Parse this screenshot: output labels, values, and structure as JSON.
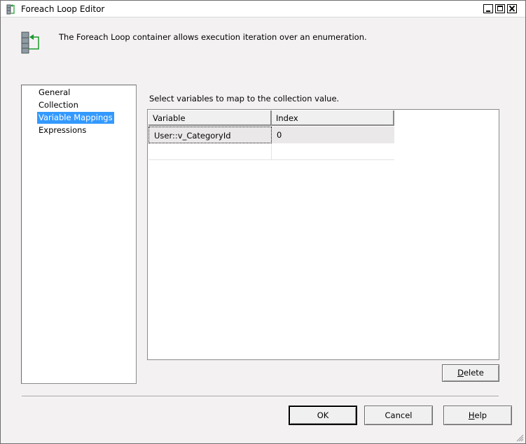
{
  "window": {
    "title": "Foreach Loop Editor"
  },
  "header": {
    "description": "The Foreach Loop container allows execution iteration over an enumeration.",
    "icon": "foreach-loop-icon"
  },
  "nav": {
    "items": [
      {
        "label": "General",
        "selected": false
      },
      {
        "label": "Collection",
        "selected": false
      },
      {
        "label": "Variable Mappings",
        "selected": true
      },
      {
        "label": "Expressions",
        "selected": false
      }
    ]
  },
  "mappings": {
    "caption": "Select variables to map to the collection value.",
    "columns": [
      "Variable",
      "Index"
    ],
    "rows": [
      {
        "variable": "User::v_CategoryId",
        "index": "0"
      }
    ]
  },
  "buttons": {
    "delete": {
      "pre": "",
      "mnemonic": "D",
      "post": "elete"
    },
    "ok": "OK",
    "cancel": "Cancel",
    "help": {
      "pre": "",
      "mnemonic": "H",
      "post": "elp"
    }
  },
  "colors": {
    "selection": "#3399ff",
    "dialog_bg": "#f4f1f3"
  }
}
